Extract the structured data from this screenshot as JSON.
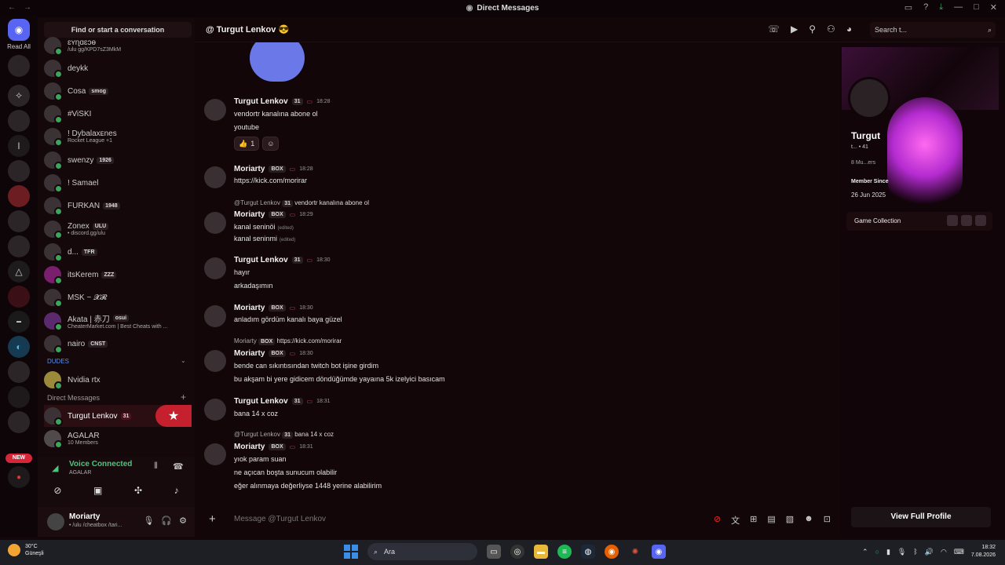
{
  "titlebar": {
    "title": "Direct Messages",
    "back": "←",
    "forward": "→"
  },
  "guilds": {
    "read_all": "Read All",
    "new_badge": "NEW",
    "items": [
      "",
      "",
      "",
      "",
      "l",
      "",
      "",
      "",
      "",
      "",
      "",
      "",
      "",
      "",
      "",
      "",
      "",
      ""
    ]
  },
  "sidebar": {
    "search": "Find or start a conversation",
    "top_partial": "ɛʏɳɑɛɔɵ",
    "top_partial_sub": "/ulu gg/KPD7sZ3MkM",
    "dms": [
      {
        "name": "deykk",
        "tag": "",
        "sub": ""
      },
      {
        "name": "Cosa",
        "tag": "smog",
        "sub": ""
      },
      {
        "name": "#ViSKİ",
        "tag": "",
        "sub": ""
      },
      {
        "name": "! Dybalaxᴇnes",
        "tag": "",
        "sub": "Rocket League +1"
      },
      {
        "name": "swenzy",
        "tag": "1926",
        "sub": ""
      },
      {
        "name": "! Samael",
        "tag": "",
        "sub": ""
      },
      {
        "name": "FURKAN",
        "tag": "1948",
        "sub": ""
      },
      {
        "name": "Zonex",
        "tag": "ULU",
        "sub": "• discord.gg/ulu"
      },
      {
        "name": "d...",
        "tag": "TFR",
        "sub": ""
      },
      {
        "name": "itsKerem",
        "tag": "ZZZ",
        "sub": ""
      },
      {
        "name": "MSK ~ 𝓧𝓡",
        "tag": "",
        "sub": ""
      },
      {
        "name": "Akata | 赤刀",
        "tag": "osui",
        "sub": "CheaterMarket.com | Best Cheats with ..."
      },
      {
        "name": "nairo",
        "tag": "CNST",
        "sub": ""
      }
    ],
    "dudes_label": "DUDES",
    "dudes_item": {
      "name": "Nvidia rtx",
      "sub": ""
    },
    "direct_messages_label": "Direct Messages",
    "active_dm": {
      "name": "Turgut Lenkov",
      "tag": "31"
    },
    "group_dm": {
      "name": "AGALAR",
      "sub": "10 Members"
    }
  },
  "voice": {
    "status": "Voice Connected",
    "channel": "AGALAR"
  },
  "user": {
    "name": "Moriarty",
    "status": "• /ulu /cheatbox /tari..."
  },
  "chat": {
    "header_name": "Turgut Lenkov",
    "header_emoji": "😎",
    "search_placeholder": "Search t...",
    "composer_placeholder": "Message @Turgut Lenkov"
  },
  "messages": {
    "m1": {
      "author": "Turgut Lenkov",
      "tag": "31",
      "time": "18:28",
      "l1": "vendortr kanalına abone ol",
      "l2": "youtube",
      "reaction_count": "1"
    },
    "m2": {
      "author": "Moriarty",
      "tag": "BOX",
      "time": "18:28",
      "link": "https://kick.com/morirar"
    },
    "m3": {
      "reply_author": "@Turgut Lenkov",
      "reply_tag": "31",
      "reply_text": "vendortr kanalına abone ol",
      "author": "Moriarty",
      "tag": "BOX",
      "time": "18:29",
      "l1": "kanal seninöi",
      "l2": "kanal seninmi",
      "edited": "(edited)"
    },
    "m4": {
      "author": "Turgut Lenkov",
      "tag": "31",
      "time": "18:30",
      "l1": "hayır",
      "l2": "arkadaşımın"
    },
    "m5": {
      "author": "Moriarty",
      "tag": "BOX",
      "time": "18:30",
      "l1": "anladım gördüm kanalı baya güzel"
    },
    "m6": {
      "reply_author": "Moriarty",
      "reply_tag": "BOX",
      "reply_text": "https://kick.com/morirar",
      "author": "Moriarty",
      "tag": "BOX",
      "time": "18:30",
      "l1": "bende can sıkıntısından twitch bot işine girdim",
      "l2": "bu akşam bi yere gidicem döndüğümde yayaına 5k izelyici basıcam"
    },
    "m7": {
      "author": "Turgut Lenkov",
      "tag": "31",
      "time": "18:31",
      "l1": "bana 14 x coz"
    },
    "m8": {
      "reply_author": "@Turgut Lenkov",
      "reply_tag": "31",
      "reply_text": "bana 14 x coz",
      "author": "Moriarty",
      "tag": "BOX",
      "time": "18:31",
      "l1": "yıok param suan",
      "l2": "ne açıcan boşta sunucum olabilir",
      "l3": "eğer alınmaya değerliyse 1448 yerine alabilirim"
    }
  },
  "profile": {
    "name": "Turgut",
    "nums": "t... • 41",
    "mutual": "8 Mu...ers",
    "member_since_label": "Member Since",
    "member_since": "26 Jun 2025",
    "game_collection": "Game Collection",
    "view_full": "View Full Profile"
  },
  "taskbar": {
    "temp": "30°C",
    "weather": "Güneşli",
    "search": "Ara",
    "time": "18:32",
    "date": "7.08.2026"
  }
}
